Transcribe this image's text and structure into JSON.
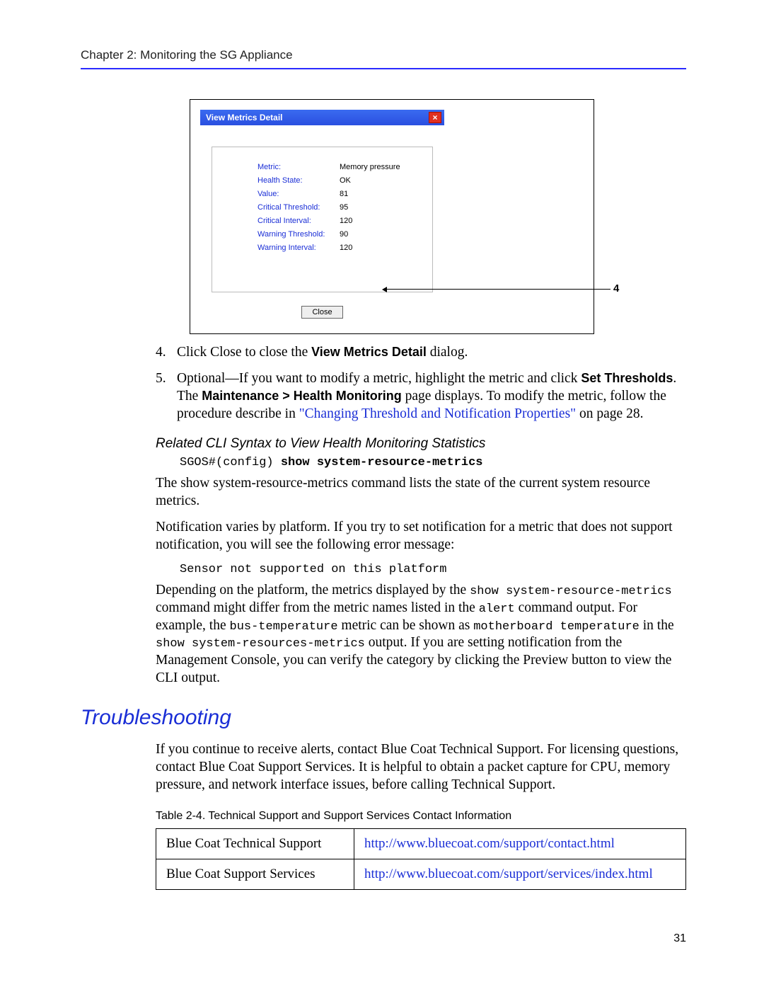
{
  "chapter_header": "Chapter 2:  Monitoring the SG Appliance",
  "dialog": {
    "title": "View Metrics Detail",
    "close_x": "×",
    "fields": [
      {
        "label": "Metric:",
        "value": "Memory pressure"
      },
      {
        "label": "Health State:",
        "value": "OK"
      },
      {
        "label": "Value:",
        "value": "81"
      },
      {
        "label": "Critical Threshold:",
        "value": "95"
      },
      {
        "label": "Critical Interval:",
        "value": "120"
      },
      {
        "label": "Warning Threshold:",
        "value": "90"
      },
      {
        "label": "Warning Interval:",
        "value": "120"
      }
    ],
    "close_button": "Close",
    "callout_number": "4"
  },
  "steps": {
    "s4": {
      "num": "4.",
      "pre": "Click Close to close the ",
      "bold": "View Metrics Detail",
      "post": " dialog."
    },
    "s5": {
      "num": "5.",
      "pre": "Optional—If you want to modify a metric, highlight the metric and click ",
      "bold1": "Set Thresholds",
      "mid1": ". The ",
      "bold2": "Maintenance > Health Monitoring",
      "mid2": " page displays. To modify the metric, follow the procedure describe in ",
      "link": "\"Changing Threshold and Notification Properties\"",
      "post": " on page 28."
    }
  },
  "subhead": "Related CLI Syntax to View Health Monitoring Statistics",
  "cli": {
    "prompt": "SGOS#(config) ",
    "cmd": "show system-resource-metrics"
  },
  "para1": "The show system-resource-metrics command lists the state of the current system resource metrics.",
  "para2": "Notification varies by platform. If you try to set notification for a metric that does not support notification, you will see the following error message:",
  "error_msg": "Sensor not supported on this platform",
  "para3": {
    "a": "Depending on the platform, the metrics displayed by the ",
    "c1": "show system-resource-metrics",
    "b": " command might differ from the metric names listed in the ",
    "c2": "alert",
    "c": " command output. For example, the ",
    "c3": "bus-temperature",
    "d": " metric can be shown as ",
    "c4": "motherboard temperature",
    "e": " in the ",
    "c5": "show system-resources-metrics",
    "f": " output. If you are setting notification from the Management Console, you can verify the category by clicking the Preview button to view the CLI output."
  },
  "troubleshooting_h": "Troubleshooting",
  "troubleshooting_p": "If you continue to receive alerts, contact Blue Coat Technical Support. For licensing questions, contact Blue Coat Support Services. It is helpful to obtain a packet capture for CPU, memory pressure, and network interface issues, before calling Technical Support.",
  "table_caption": "Table 2-4.   Technical Support and Support Services Contact Information",
  "table": {
    "r1": {
      "label": "Blue Coat Technical Support",
      "url": "http://www.bluecoat.com/support/contact.html"
    },
    "r2": {
      "label": "Blue Coat Support Services",
      "url": "http://www.bluecoat.com/support/services/index.html"
    }
  },
  "page_number": "31"
}
